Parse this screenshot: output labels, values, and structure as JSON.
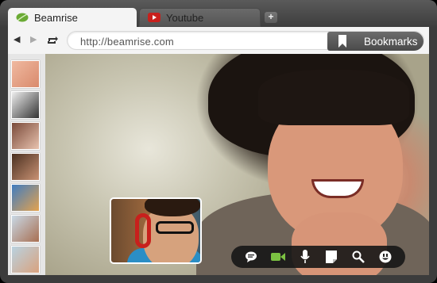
{
  "tabs": [
    {
      "label": "Beamrise",
      "icon": "leaf-icon",
      "active": true
    },
    {
      "label": "Youtube",
      "icon": "youtube-icon",
      "active": false
    }
  ],
  "new_tab_label": "+",
  "nav": {
    "back_icon": "back-arrow-icon",
    "forward_icon": "forward-arrow-icon",
    "reload_icon": "reload-icon"
  },
  "address": {
    "url": "http://beamrise.com"
  },
  "bookmarks": {
    "label": "Bookmarks",
    "icon": "bookmark-icon"
  },
  "sidebar": {
    "contacts": [
      {
        "icon": "contact-avatar"
      },
      {
        "icon": "contact-avatar"
      },
      {
        "icon": "contact-avatar"
      },
      {
        "icon": "contact-avatar"
      },
      {
        "icon": "contact-avatar"
      },
      {
        "icon": "contact-avatar"
      },
      {
        "icon": "contact-avatar"
      }
    ]
  },
  "call_toolbar": {
    "buttons": [
      {
        "icon": "chat-icon"
      },
      {
        "icon": "video-camera-icon",
        "color": "#7bc142"
      },
      {
        "icon": "microphone-icon"
      },
      {
        "icon": "note-icon"
      },
      {
        "icon": "search-icon"
      },
      {
        "icon": "emoticon-icon"
      }
    ]
  },
  "colors": {
    "chrome_dark": "#3c3c3c",
    "tab_active": "#f4f4f4",
    "accent_green": "#7bc142",
    "youtube_red": "#c8201c"
  }
}
